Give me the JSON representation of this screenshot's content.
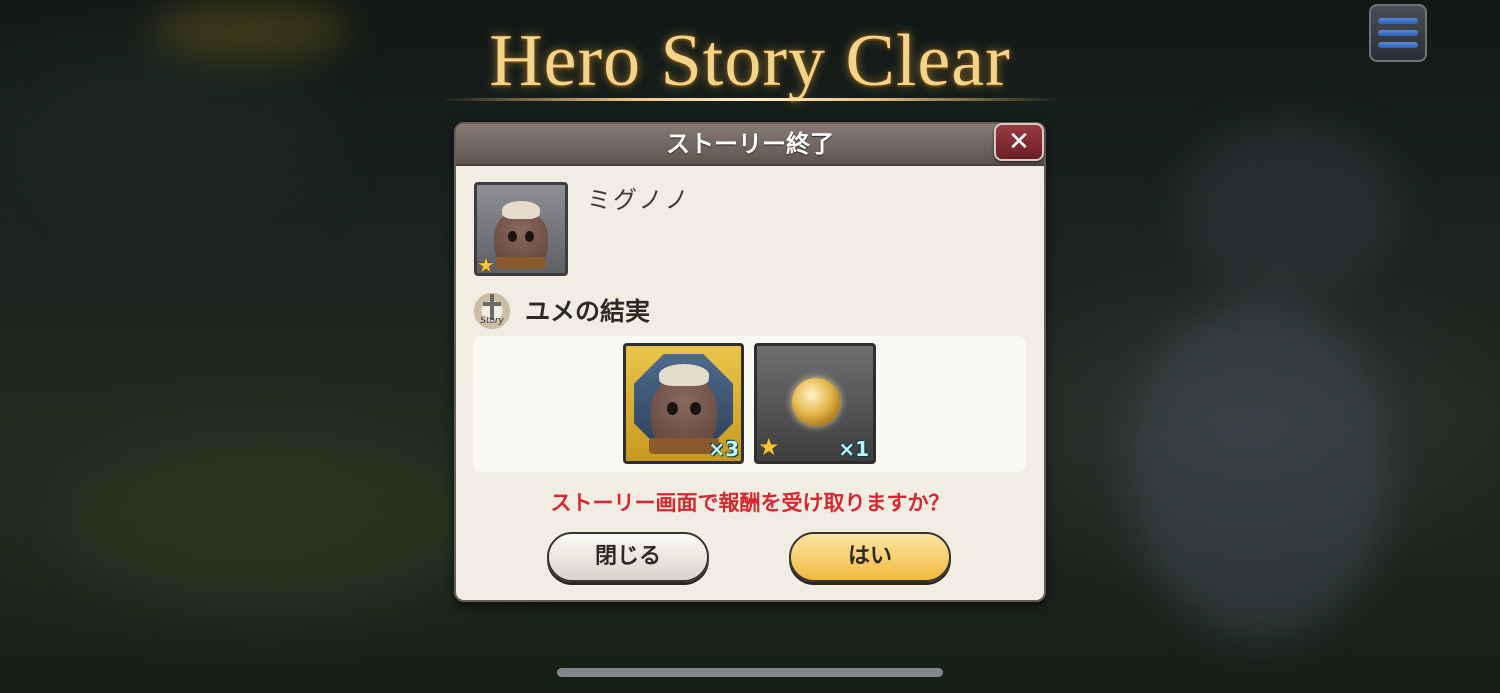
{
  "banner": {
    "title": "Hero Story Clear"
  },
  "dialog": {
    "title": "ストーリー終了",
    "close_glyph": "✕",
    "hero_name": "ミグノノ",
    "story_title": "ユメの結実",
    "story_icon_label": "Story",
    "rewards": [
      {
        "name": "hero-portrait-reward",
        "quantity": "×3"
      },
      {
        "name": "gold-medal-reward",
        "quantity": "×1",
        "rarity_stars": 1
      }
    ],
    "prompt": "ストーリー画面で報酬を受け取りますか？",
    "close_button": "閉じる",
    "yes_button": "はい"
  },
  "hero": {
    "rarity_stars": 1
  },
  "icons": {
    "menu": "hamburger-menu-icon",
    "close": "close-icon",
    "story": "story-sword-icon",
    "star": "star-icon",
    "coin": "gold-medal-icon"
  },
  "colors": {
    "prompt": "#d7282f",
    "yes_button": "#f0b93f",
    "close_button": "#7a2a32",
    "banner_gold": "#f4d48a"
  }
}
